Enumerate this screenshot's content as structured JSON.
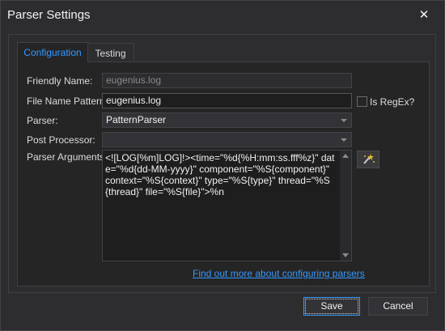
{
  "window": {
    "title": "Parser Settings",
    "close_glyph": "✕"
  },
  "tabs": [
    {
      "label": "Configuration",
      "active": true
    },
    {
      "label": "Testing",
      "active": false
    }
  ],
  "form": {
    "friendly_name": {
      "label": "Friendly Name:",
      "value": "eugenius.log"
    },
    "file_name_pattern": {
      "label": "File Name Pattern:",
      "value": "eugenius.log"
    },
    "is_regex": {
      "label": "Is RegEx?",
      "checked": false
    },
    "parser": {
      "label": "Parser:",
      "value": "PatternParser"
    },
    "post_processor": {
      "label": "Post Processor:",
      "value": ""
    },
    "parser_arguments": {
      "label": "Parser Arguments:",
      "value": "<![LOG[%m]LOG]!><time=\"%d{%H:mm:ss.fff%z}\" date=\"%d{dd-MM-yyyy}\" component=\"%S{component}\" context=\"%S{context}\" type=\"%S{type}\" thread=\"%S{thread}\" file=\"%S{file}\">%n"
    }
  },
  "help_link": "Find out more about configuring parsers",
  "buttons": {
    "save": "Save",
    "cancel": "Cancel"
  },
  "icons": {
    "wand": "magic-wand-icon"
  },
  "colors": {
    "accent": "#3399ff",
    "background": "#2d2d30",
    "panel": "#252526"
  }
}
